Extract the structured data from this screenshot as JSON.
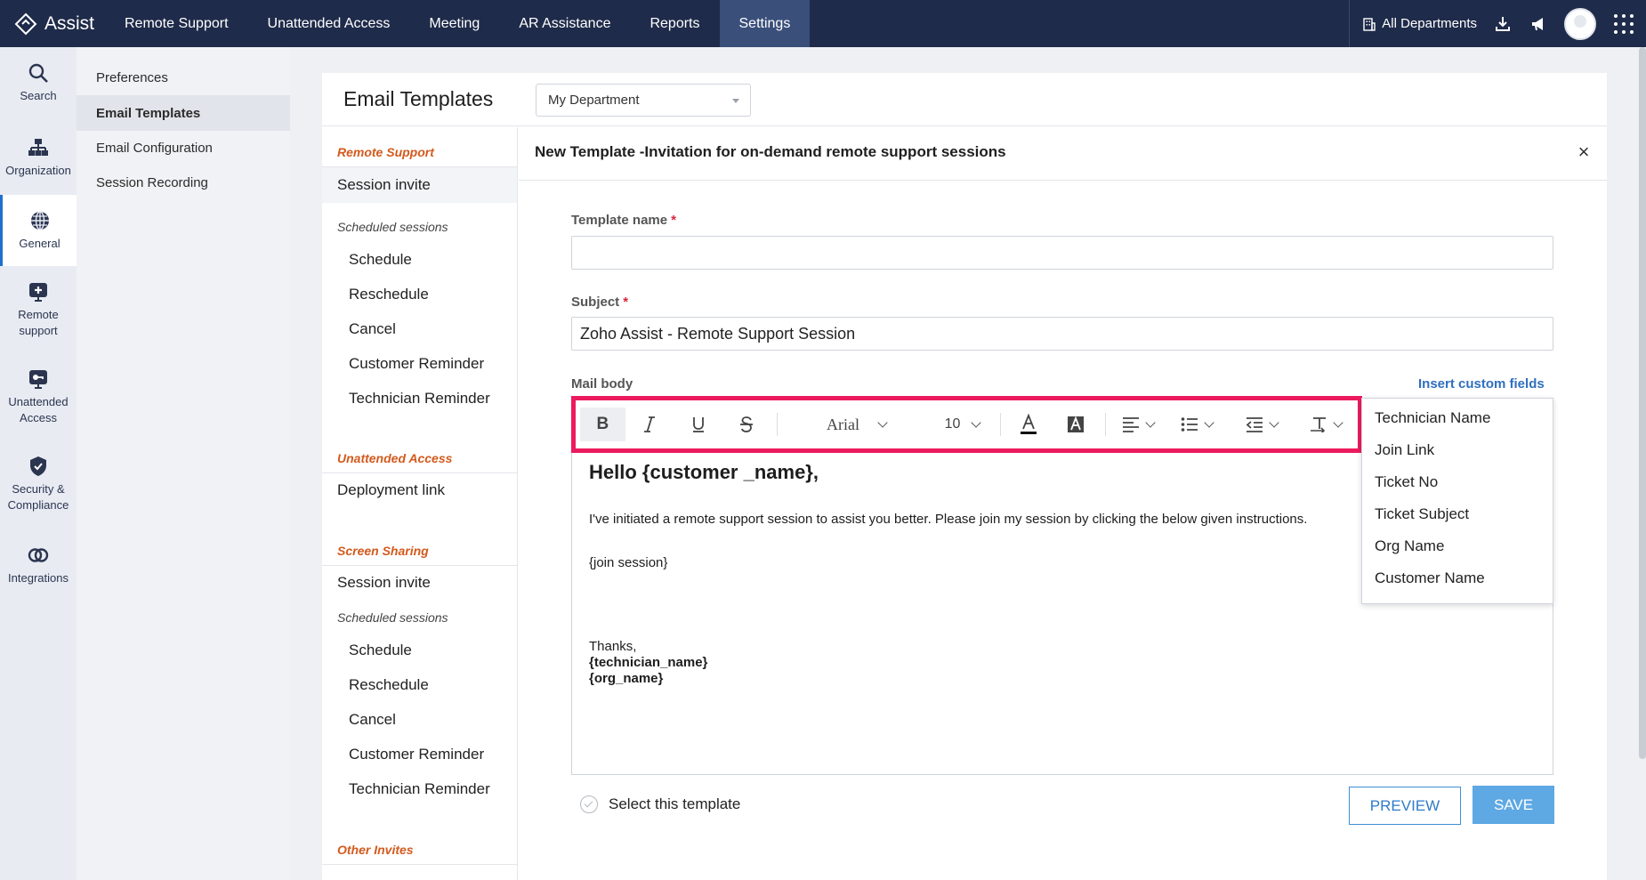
{
  "app": {
    "brand": "Assist"
  },
  "topnav": {
    "items": [
      "Remote Support",
      "Unattended Access",
      "Meeting",
      "AR Assistance",
      "Reports",
      "Settings"
    ],
    "active": "Settings",
    "department_label": "All Departments"
  },
  "rail": {
    "items": [
      {
        "label": "Search",
        "icon": "search-icon"
      },
      {
        "label": "Organization",
        "icon": "organization-icon"
      },
      {
        "label": "General",
        "icon": "globe-icon"
      },
      {
        "label": "Remote support",
        "icon": "remote-support-icon"
      },
      {
        "label": "Unattended Access",
        "icon": "unattended-access-icon"
      },
      {
        "label": "Security & Compliance",
        "icon": "shield-icon"
      },
      {
        "label": "Integrations",
        "icon": "integrations-icon"
      }
    ],
    "active": "General"
  },
  "submenu": {
    "items": [
      "Preferences",
      "Email Templates",
      "Email Configuration",
      "Session Recording"
    ],
    "active": "Email Templates"
  },
  "page": {
    "title": "Email Templates",
    "department_select": "My Department"
  },
  "template_list": {
    "remote_support": {
      "title": "Remote Support",
      "session_invite": "Session invite",
      "scheduled_title": "Scheduled sessions",
      "scheduled": [
        "Schedule",
        "Reschedule",
        "Cancel",
        "Customer Reminder",
        "Technician Reminder"
      ]
    },
    "unattended_access": {
      "title": "Unattended Access",
      "deployment_link": "Deployment link"
    },
    "screen_sharing": {
      "title": "Screen Sharing",
      "session_invite": "Session invite",
      "scheduled_title": "Scheduled sessions",
      "scheduled": [
        "Schedule",
        "Reschedule",
        "Cancel",
        "Customer Reminder",
        "Technician Reminder"
      ]
    },
    "other_invites": {
      "title": "Other Invites"
    }
  },
  "editor": {
    "title": "New Template -Invitation for on-demand remote support sessions",
    "close": "×",
    "template_name_label": "Template name",
    "template_name_value": "",
    "subject_label": "Subject",
    "subject_value": "Zoho Assist - Remote Support Session",
    "mail_body_label": "Mail body",
    "insert_custom_fields": "Insert custom fields",
    "toolbar": {
      "bold": "B",
      "font": "Arial",
      "size": "10"
    },
    "body": {
      "greeting": "Hello {customer _name},",
      "paragraph": "I've initiated a remote support session to assist you better. Please join my session by clicking the below given instructions.",
      "join": "{join session}",
      "thanks": "Thanks,",
      "technician": "{technician_name}",
      "org": "{org_name}"
    },
    "custom_fields": [
      "Technician Name",
      "Join Link",
      "Ticket No",
      "Ticket Subject",
      "Org Name",
      "Customer Name"
    ],
    "select_template": "Select this template",
    "preview": "PREVIEW",
    "save": "SAVE"
  },
  "colors": {
    "topbar": "#1f2b4a",
    "section_title": "#d35a1d",
    "toolbar_highlight": "#ec1a5e",
    "link": "#2f6fbf",
    "save": "#5ea8e4"
  }
}
